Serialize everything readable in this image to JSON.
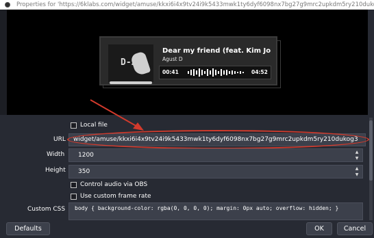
{
  "window": {
    "title": "Properties for 'https://6klabs.com/widget/amuse/kkxi6i4x9tv24i9k5433mwk1ty6dyf6098nx7bg27g9mrc2upkdm5ry210duko"
  },
  "preview": {
    "album_text": "D-2",
    "song_title": "Dear my friend (feat. Kim Jon",
    "artist": "Agust D",
    "time_current": "00:41",
    "time_total": "04:52"
  },
  "form": {
    "local_file_label": "Local file",
    "local_file_checked": false,
    "url_label": "URL",
    "url_value": "widget/amuse/kkxi6i4x9tv24i9k5433mwk1ty6dyf6098nx7bg27g9mrc2upkdm5ry210dukog3",
    "width_label": "Width",
    "width_value": "1200",
    "height_label": "Height",
    "height_value": "350",
    "control_audio_label": "Control audio via OBS",
    "control_audio_checked": false,
    "custom_frame_label": "Use custom frame rate",
    "custom_frame_checked": false,
    "custom_css_label": "Custom CSS",
    "custom_css_value": "body { background-color: rgba(0, 0, 0, 0); margin: 0px auto; overflow: hidden; }"
  },
  "buttons": {
    "defaults": "Defaults",
    "ok": "OK",
    "cancel": "Cancel"
  },
  "annotation": {
    "highlight_color": "#d23a2c"
  }
}
